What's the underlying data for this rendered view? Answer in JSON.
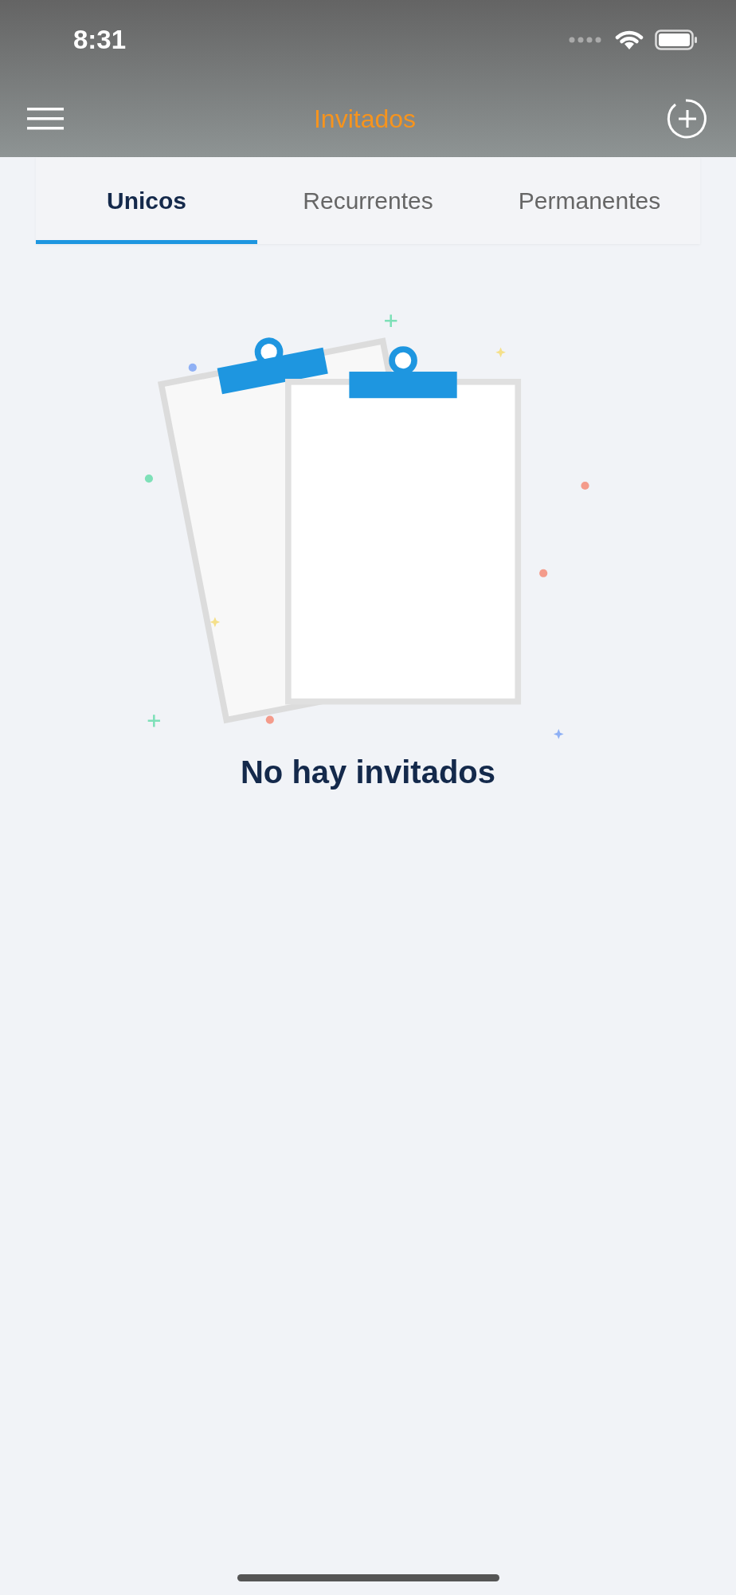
{
  "status_bar": {
    "time": "8:31"
  },
  "header": {
    "title": "Invitados"
  },
  "tabs": [
    {
      "label": "Unicos",
      "selected": true
    },
    {
      "label": "Recurrentes",
      "selected": false
    },
    {
      "label": "Permanentes",
      "selected": false
    }
  ],
  "empty_state": {
    "message": "No hay invitados"
  }
}
